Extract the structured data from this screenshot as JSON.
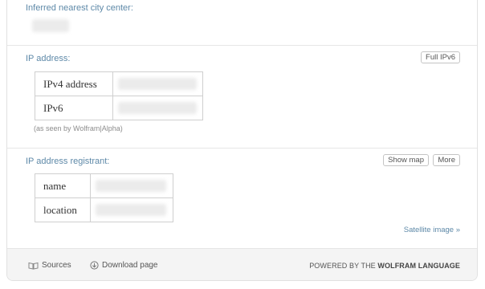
{
  "pods": {
    "city": {
      "title": "Inferred nearest city center:"
    },
    "ip": {
      "title": "IP address:",
      "button": "Full IPv6",
      "rows": [
        {
          "label": "IPv4 address"
        },
        {
          "label": "IPv6"
        }
      ],
      "note": "(as seen by Wolfram|Alpha)"
    },
    "registrant": {
      "title": "IP address registrant:",
      "buttons": {
        "show_map": "Show map",
        "more": "More"
      },
      "rows": [
        {
          "label": "name"
        },
        {
          "label": "location"
        }
      ],
      "link": "Satellite image »"
    }
  },
  "footer": {
    "sources": "Sources",
    "download": "Download page",
    "powered_prefix": "POWERED BY THE",
    "powered_brand": "WOLFRAM LANGUAGE"
  }
}
